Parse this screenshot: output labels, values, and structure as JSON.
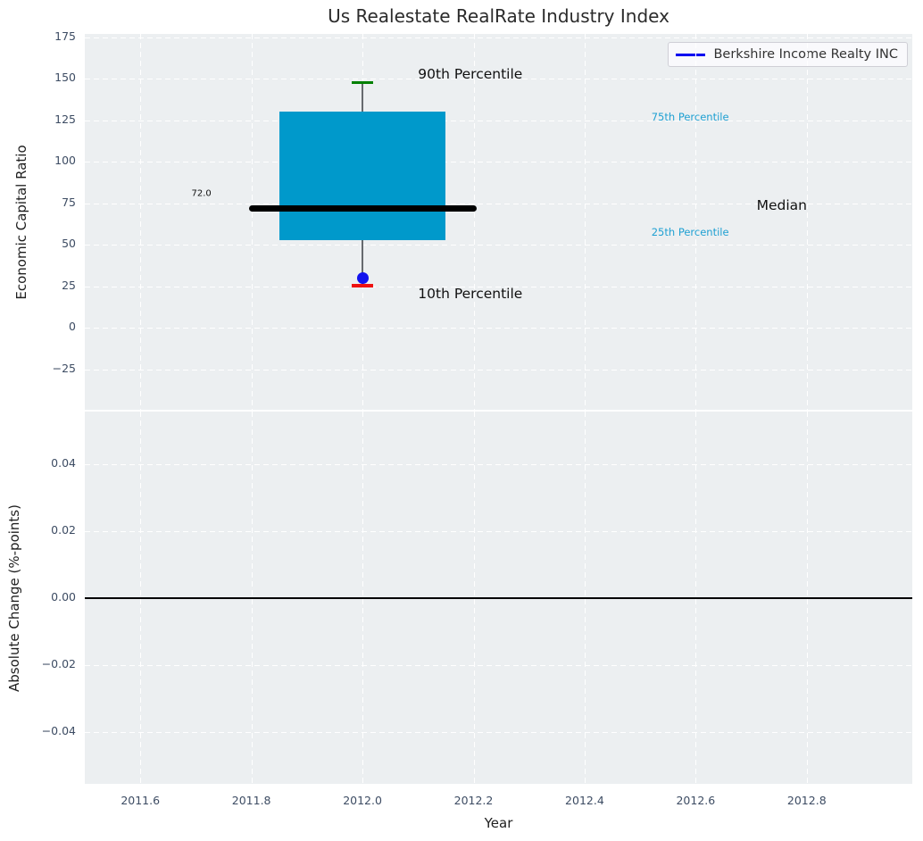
{
  "title": "Us Realestate RealRate Industry Index",
  "legend": {
    "label": "Berkshire Income Realty INC",
    "line_color": "#0000f0"
  },
  "chart_data": [
    {
      "type": "boxplot",
      "panel": "top",
      "title": "Us Realestate RealRate Industry Index",
      "ylabel": "Economic Capital Ratio",
      "ylim": [
        -49.4,
        177
      ],
      "xlim": [
        2011.5,
        2012.99
      ],
      "grid": true,
      "yticks": [
        {
          "v": 175,
          "label": "175"
        },
        {
          "v": 150,
          "label": "150"
        },
        {
          "v": 125,
          "label": "125"
        },
        {
          "v": 100,
          "label": "100"
        },
        {
          "v": 75,
          "label": "75"
        },
        {
          "v": 50,
          "label": "50"
        },
        {
          "v": 25,
          "label": "25"
        },
        {
          "v": 0,
          "label": "0"
        },
        {
          "v": -25,
          "label": "−25"
        }
      ],
      "box": {
        "x": 2012.0,
        "q1": 53,
        "median": 72.0,
        "q3": 130,
        "p10": 26,
        "p90": 148,
        "median_label": "72.0",
        "box_halfwidth": 0.15,
        "median_halfwidth": 0.205
      },
      "company_point": {
        "name": "Berkshire Income Realty INC",
        "x": 2012.0,
        "y": 30
      },
      "annotations": [
        {
          "text": "90th Percentile",
          "x": 2012.1,
          "y": 153,
          "anchor": "left",
          "style": "big-black"
        },
        {
          "text": "10th Percentile",
          "x": 2012.1,
          "y": 20.5,
          "anchor": "left",
          "style": "big-black"
        },
        {
          "text": "72.0",
          "x": 2011.71,
          "y": 80.5,
          "anchor": "center",
          "style": "small-black"
        },
        {
          "text": "75th Percentile",
          "x": 2012.59,
          "y": 127,
          "anchor": "center",
          "style": "cyan"
        },
        {
          "text": "25th Percentile",
          "x": 2012.59,
          "y": 57.5,
          "anchor": "center",
          "style": "cyan"
        },
        {
          "text": "Median",
          "x": 2012.755,
          "y": 73.5,
          "anchor": "center",
          "style": "median-black"
        }
      ]
    },
    {
      "type": "line",
      "panel": "bottom",
      "ylabel": "Absolute Change (%-points)",
      "xlabel": "Year",
      "ylim": [
        -0.0555,
        0.0557
      ],
      "xlim": [
        2011.5,
        2012.99
      ],
      "grid": true,
      "zero_line": 0.0,
      "yticks": [
        {
          "v": 0.04,
          "label": "0.04"
        },
        {
          "v": 0.02,
          "label": "0.02"
        },
        {
          "v": 0.0,
          "label": "0.00"
        },
        {
          "v": -0.02,
          "label": "−0.02"
        },
        {
          "v": -0.04,
          "label": "−0.04"
        }
      ],
      "xticks": [
        {
          "v": 2011.6,
          "label": "2011.6"
        },
        {
          "v": 2011.8,
          "label": "2011.8"
        },
        {
          "v": 2012.0,
          "label": "2012.0"
        },
        {
          "v": 2012.2,
          "label": "2012.2"
        },
        {
          "v": 2012.4,
          "label": "2012.4"
        },
        {
          "v": 2012.6,
          "label": "2012.6"
        },
        {
          "v": 2012.8,
          "label": "2012.8"
        }
      ],
      "series": [
        {
          "name": "Berkshire Income Realty INC",
          "points": []
        }
      ]
    }
  ],
  "colors": {
    "panel_background": "#eceff1",
    "grid": "#ffffff",
    "box_fill": "#0099cb",
    "whisker": "#666a6e",
    "cap_90th": "#008000",
    "cap_10th": "#ee1111",
    "company_dot": "#1313ee",
    "median_line": "#000000",
    "percentile_text": "#1fa0d2",
    "tick_text": "#3d4c63",
    "legend_line": "#0000f0"
  }
}
